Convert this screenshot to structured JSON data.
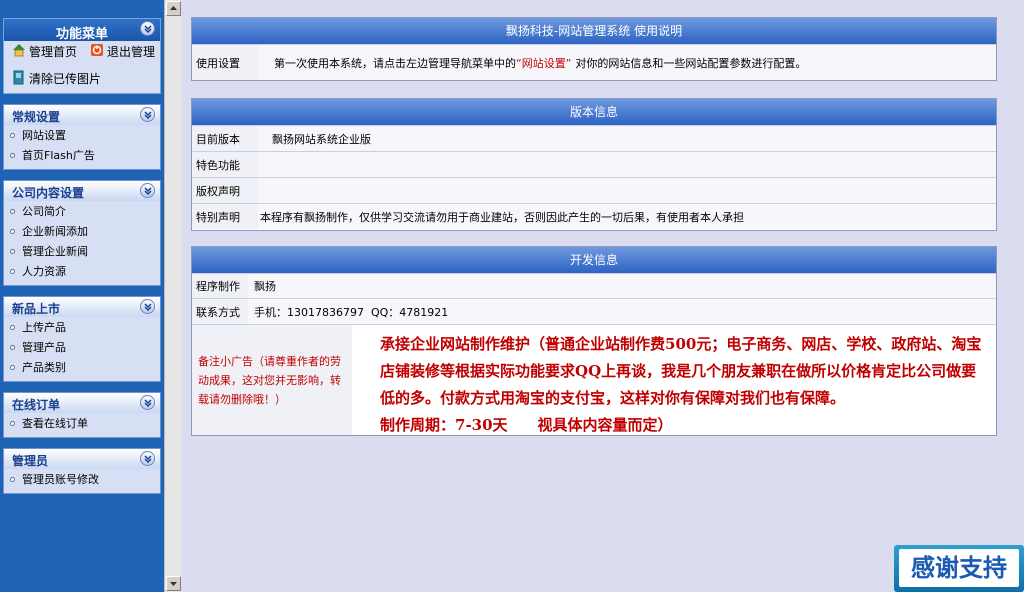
{
  "sidebar": {
    "function_menu": {
      "title": "功能菜单",
      "quick_links": [
        {
          "label": "管理首页",
          "icon": "home-icon"
        },
        {
          "label": "退出管理",
          "icon": "exit-icon"
        },
        {
          "label": "清除已传图片",
          "icon": "clear-images-icon"
        }
      ]
    },
    "panels": [
      {
        "title": "常规设置",
        "items": [
          "网站设置",
          "首页Flash广告"
        ]
      },
      {
        "title": "公司内容设置",
        "items": [
          "公司简介",
          "企业新闻添加",
          "管理企业新闻",
          "人力资源"
        ]
      },
      {
        "title": "新品上市",
        "items": [
          "上传产品",
          "管理产品",
          "产品类别"
        ]
      },
      {
        "title": "在线订单",
        "items": [
          "查看在线订单"
        ]
      },
      {
        "title": "管理员",
        "items": [
          "管理员账号修改"
        ]
      }
    ]
  },
  "usage": {
    "header": "飘扬科技-网站管理系统 使用说明",
    "label": "使用设置",
    "text_before": "第一次使用本系统，请点击左边管理导航菜单中的",
    "highlight": "“网站设置”",
    "text_after": "对你的网站信息和一些网站配置参数进行配置。"
  },
  "version": {
    "header": "版本信息",
    "rows": [
      {
        "label": "目前版本",
        "value": "飘扬网站系统企业版"
      },
      {
        "label": "特色功能",
        "value": ""
      },
      {
        "label": "版权声明",
        "value": ""
      },
      {
        "label": "特别声明",
        "value": "本程序有飘扬制作，仅供学习交流请勿用于商业建站，否则因此产生的一切后果，有使用者本人承担"
      }
    ]
  },
  "dev": {
    "header": "开发信息",
    "author_label": "程序制作",
    "author": "飘扬",
    "contact_label": "联系方式",
    "contact": "手机：13017836797  QQ：4781921",
    "ad_note": "备注小广告（请尊重作者的劳动成果，这对您并无影响，转载请勿删除哦！）",
    "ad_text": "承接企业网站制作维护（普通企业站制作费500元；电子商务、网店、学校、政府站、淘宝店铺装修等根据实际功能要求QQ上再谈，我是几个朋友兼职在做所以价格肯定比公司做要低的多。付款方式用淘宝的支付宝，这样对你有保障对我们也有保障。",
    "period": "制作周期：7-30天　　视具体内容量而定）"
  },
  "thanks": "感谢支持",
  "colors": {
    "sidebar_bg": "#1e63b4",
    "header_blue": "#2c63c4",
    "highlight_red": "#c00000"
  }
}
